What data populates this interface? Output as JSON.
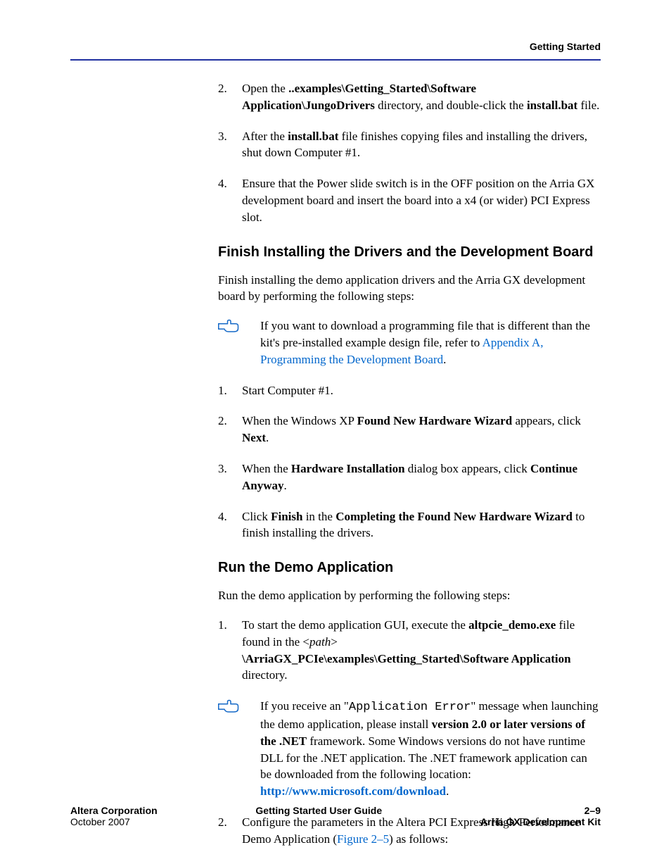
{
  "header": {
    "running_title": "Getting Started"
  },
  "s1": {
    "item2": {
      "num": "2.",
      "p_a": "Open the ",
      "p_b_bold": "..examples\\Getting_Started\\Software Application\\JungoDrivers",
      "p_c": " directory, and double-click the ",
      "p_d_bold": "install.bat",
      "p_e": " file."
    },
    "item3": {
      "num": "3.",
      "p_a": "After the ",
      "p_b_bold": "install.bat",
      "p_c": " file finishes copying files and installing the drivers, shut down Computer #1."
    },
    "item4": {
      "num": "4.",
      "p": "Ensure that the Power slide switch is in the OFF position on the Arria GX development board and insert the board into a x4 (or wider) PCI Express slot."
    }
  },
  "h_finish": "Finish Installing the Drivers and the Development Board",
  "finish_intro": "Finish installing the demo application drivers and the Arria GX development board by performing the following steps:",
  "finish_note": {
    "a": "If you want to download a programming file that is different than the kit's pre-installed example design file, refer to ",
    "link": "Appendix A, Programming the Development Board",
    "b": "."
  },
  "s2": {
    "item1": {
      "num": "1.",
      "p": "Start Computer #1."
    },
    "item2": {
      "num": "2.",
      "a": "When the Windows XP ",
      "b_bold": "Found New Hardware Wizard",
      "c": " appears, click ",
      "d_bold": "Next",
      "e": "."
    },
    "item3": {
      "num": "3.",
      "a": "When the ",
      "b_bold": "Hardware Installation",
      "c": " dialog box appears, click ",
      "d_bold": "Continue Anyway",
      "e": "."
    },
    "item4": {
      "num": "4.",
      "a": "Click ",
      "b_bold": "Finish",
      "c": " in the ",
      "d_bold": "Completing the Found New Hardware Wizard",
      "e": " to finish installing the drivers."
    }
  },
  "h_run": "Run the Demo Application",
  "run_intro": "Run the demo application by performing the following steps:",
  "s3": {
    "item1": {
      "num": "1.",
      "a": "To start the demo application GUI, execute the ",
      "b_bold": "altpcie_demo.exe",
      "c": " file found in the <",
      "d_italic": "path",
      "e": "> ",
      "f_bold": "\\ArriaGX_PCIe\\examples\\Getting_Started\\Software Application",
      "g": " directory."
    },
    "note": {
      "a": "If you receive an \"",
      "code": "Application Error",
      "b": "\" message when launching the demo application, please install ",
      "c_bold": "version 2.0 or later versions of the .NET",
      "d": " framework. Some Windows versions do not have runtime DLL for the .NET application. The .NET framework application can be downloaded from the following location: ",
      "url": "http://www.microsoft.com/download",
      "e": "."
    },
    "item2": {
      "num": "2.",
      "a": "Configure the parameters in the Altera PCI Express High-Performance Demo Application (",
      "figref": "Figure 2–5",
      "b": ") as follows:"
    }
  },
  "footer": {
    "left1": "Altera Corporation",
    "left2": "October 2007",
    "center": "Getting Started User Guide",
    "right1": "2–9",
    "right2": "Arria GX Development Kit"
  }
}
